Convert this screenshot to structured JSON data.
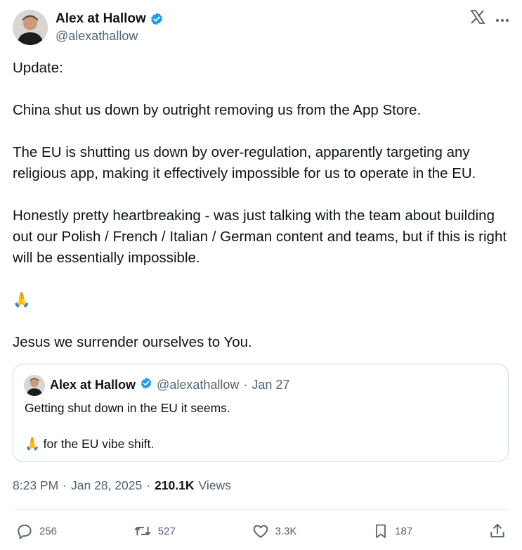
{
  "author": {
    "name": "Alex at Hallow",
    "handle": "@alexathallow"
  },
  "header_icons": {
    "logo": "x-logo-icon",
    "more": "more-dots-icon"
  },
  "post": {
    "lines": [
      "Update:",
      "China shut us down by outright removing us from the App Store.",
      "The EU is shutting us down by over-regulation, apparently targeting any religious app, making it effectively impossible for us to operate in the EU.",
      "Honestly pretty heartbreaking - was just talking with the team about building out our Polish / French / Italian / German content and teams, but if this is right will be essentially impossible.",
      "🙏",
      "Jesus we surrender ourselves to You."
    ]
  },
  "quote": {
    "name": "Alex at Hallow",
    "handle": "@alexathallow",
    "sep": "·",
    "date": "Jan 27",
    "line1": "Getting shut down in the EU it seems.",
    "line2": "🙏 for the EU vibe shift."
  },
  "meta": {
    "time": "8:23 PM",
    "sep1": "·",
    "date": "Jan 28, 2025",
    "sep2": "·",
    "views_count": "210.1K",
    "views_label": "Views"
  },
  "actions": {
    "replies": "256",
    "reposts": "527",
    "likes": "3.3K",
    "bookmarks": "187"
  },
  "colors": {
    "text": "#0f1419",
    "secondary": "#536471",
    "verified": "#1d9bf0",
    "border": "#cfd9de"
  }
}
